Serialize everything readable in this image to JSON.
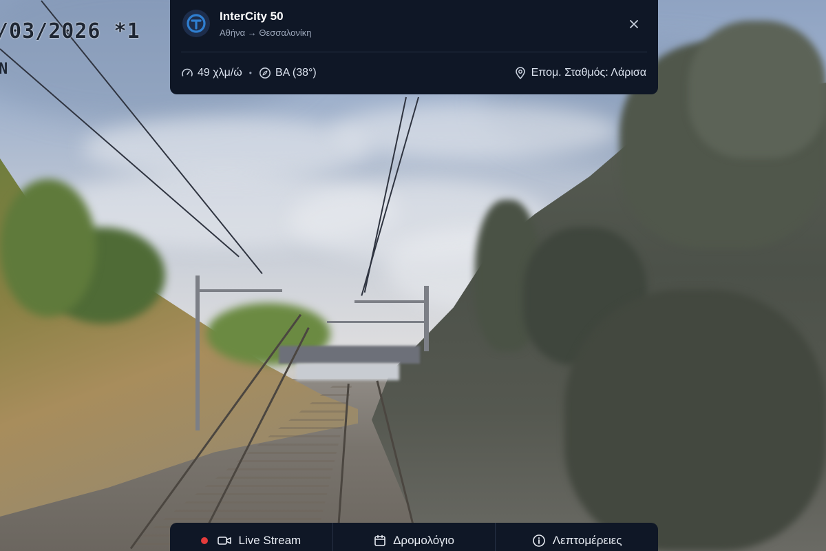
{
  "feed": {
    "timestamp": "/03/2026 *1",
    "overlay_mark": "N"
  },
  "train": {
    "name": "InterCity 50",
    "route": "Αθήνα → Θεσσαλονίκη",
    "logo_icon": "train-operator-logo-icon",
    "accent_color": "#2f7fd1"
  },
  "stats": {
    "speed": "49 χλμ/ώ",
    "separator": "•",
    "heading": "ΒΑ (38°)",
    "next_station": "Επομ. Σταθμός: Λάρισα"
  },
  "tabs": [
    {
      "label": "Live Stream",
      "icon": "video-camera-icon",
      "live_indicator_color": "#e53b3b"
    },
    {
      "label": "Δρομολόγιο",
      "icon": "calendar-icon"
    },
    {
      "label": "Λεπτομέρειες",
      "icon": "info-icon"
    }
  ],
  "colors": {
    "panel_bg": "#0f1726",
    "text_secondary": "#9aa5b8"
  }
}
